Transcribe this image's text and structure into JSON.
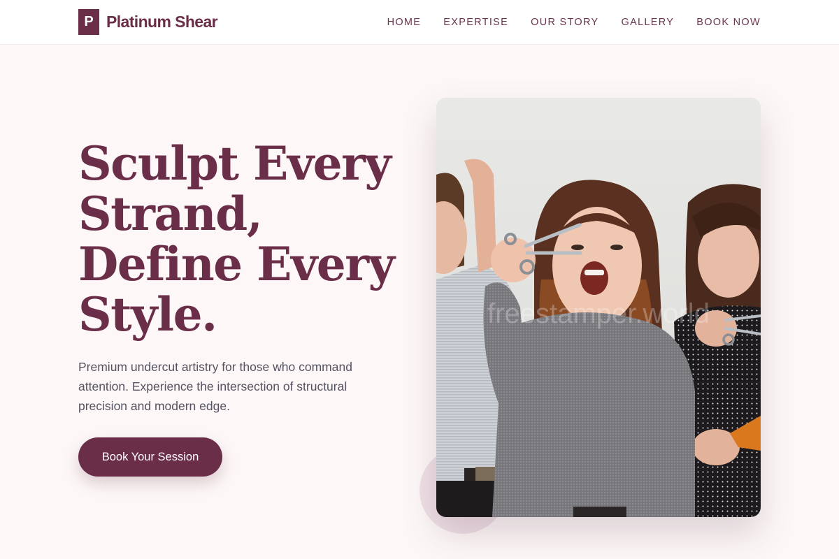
{
  "brand": {
    "mark": "P",
    "name": "Platinum Shear",
    "color": "#6b2e49"
  },
  "nav": {
    "items": [
      {
        "label": "HOME"
      },
      {
        "label": "EXPERTISE"
      },
      {
        "label": "OUR STORY"
      },
      {
        "label": "GALLERY"
      },
      {
        "label": "BOOK NOW"
      }
    ]
  },
  "hero": {
    "title_lines": [
      "Sculpt Every",
      "Strand,",
      "Define Every",
      "Style."
    ],
    "description": "Premium undercut artistry for those who command attention. Experience the intersection of structural precision and modern edge.",
    "cta_label": "Book Your Session",
    "image": {
      "subject": "three-stylists-with-scissors-photo",
      "watermark": "freestamper.world"
    }
  },
  "colors": {
    "accent": "#6b2e49",
    "background": "#fdf8f7",
    "body_text": "#555262",
    "deco_circle": "#efe0e6"
  }
}
